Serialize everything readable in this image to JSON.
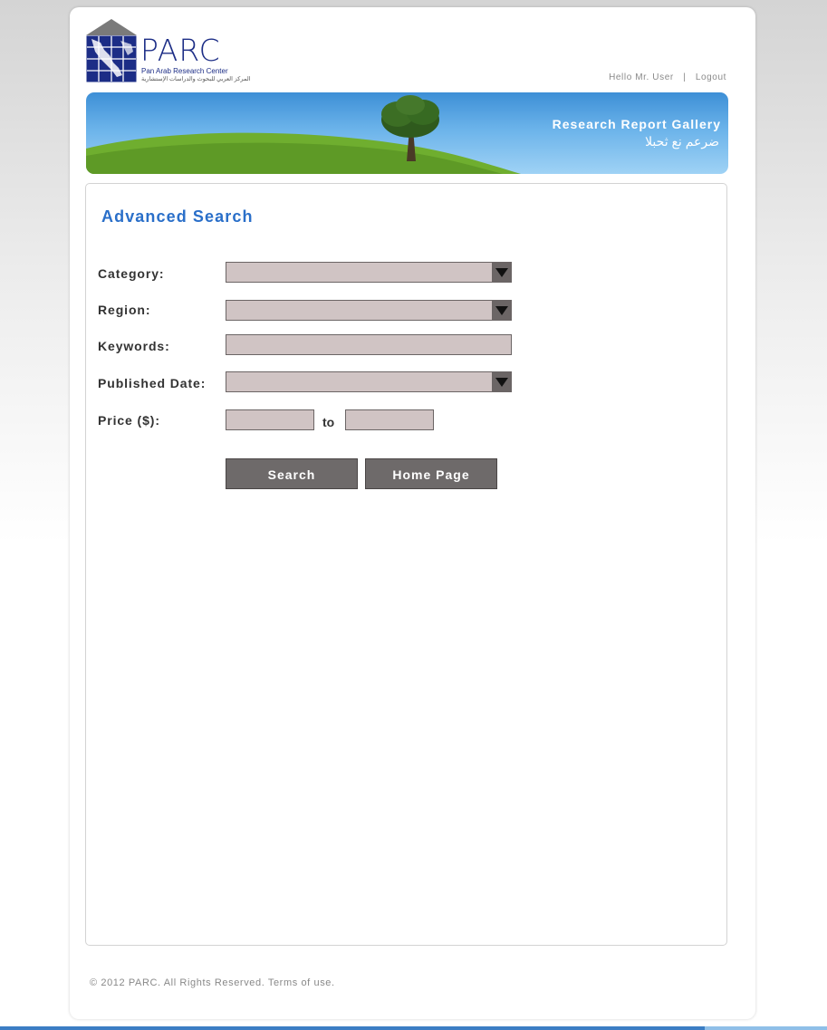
{
  "brand": {
    "name": "PARC",
    "tagline": "Pan Arab Research Center",
    "tagline_ar": "المركز العربي للبحوث والدراسات الإستشارية",
    "color": "#1c2d86"
  },
  "userbar": {
    "greeting": "Hello Mr. User",
    "separator": "|",
    "logout": "Logout"
  },
  "banner": {
    "title": "Research Report Gallery",
    "title_ar": "ضرعم نع ثحبلا"
  },
  "form": {
    "heading": "Advanced Search",
    "category_label": "Category:",
    "category_value": "",
    "region_label": "Region:",
    "region_value": "",
    "keywords_label": "Keywords:",
    "keywords_value": "",
    "published_label": "Published Date:",
    "published_value": "",
    "price_label": "Price ($):",
    "price_from": "",
    "price_to_label": "to",
    "price_to": "",
    "search_button": "Search",
    "home_button": "Home Page"
  },
  "footer": {
    "copyright": "© 2012 PARC. All Rights Reserved.",
    "terms": "Terms of use."
  },
  "colors": {
    "accent": "#2a6fc9",
    "field_bg": "#d0c4c4",
    "button_bg": "#6e6a6a"
  }
}
